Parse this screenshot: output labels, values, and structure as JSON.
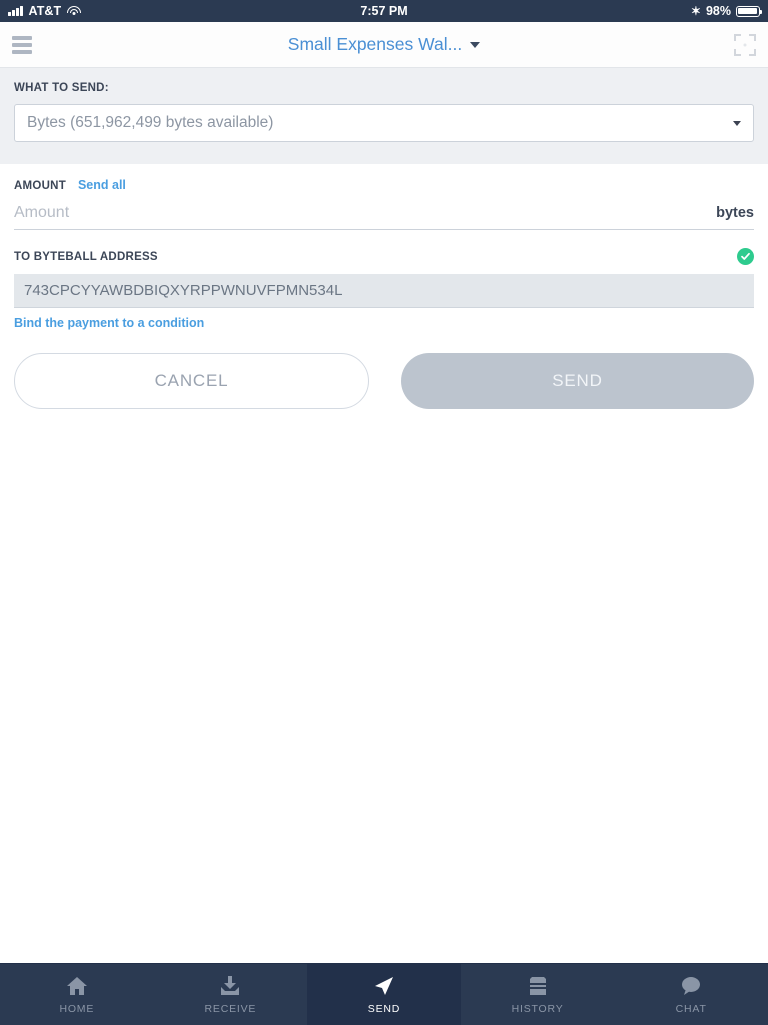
{
  "statusbar": {
    "carrier": "AT&T",
    "time": "7:57 PM",
    "battery": "98%",
    "bluetooth_icon": "bluetooth-icon",
    "wifi_icon": "wifi-icon",
    "signal_icon": "signal-bars-icon"
  },
  "navbar": {
    "menu_icon": "hamburger-menu-icon",
    "title": "Small Expenses Wal...",
    "caret_icon": "chevron-down-icon",
    "scan_icon": "scan-qr-icon"
  },
  "what_to_send": {
    "label": "WHAT TO SEND:",
    "selected": "Bytes (651,962,499 bytes available)",
    "options": [
      "Bytes (651,962,499 bytes available)"
    ],
    "arrow_icon": "dropdown-arrow-icon"
  },
  "amount": {
    "label": "AMOUNT",
    "send_all_label": "Send all",
    "value": "",
    "placeholder": "Amount",
    "unit": "bytes"
  },
  "address": {
    "label": "TO BYTEBALL ADDRESS",
    "value": "743CPCYYAWBDBIQXYRPPWNUVFPMN534L",
    "placeholder": "",
    "valid_icon": "check-circle-icon",
    "bind_link_label": "Bind the payment to a condition"
  },
  "actions": {
    "cancel_label": "CANCEL",
    "send_label": "SEND"
  },
  "tabbar": {
    "items": [
      {
        "label": "HOME",
        "icon": "home-icon",
        "active": false
      },
      {
        "label": "RECEIVE",
        "icon": "receive-icon",
        "active": false
      },
      {
        "label": "SEND",
        "icon": "send-icon",
        "active": true
      },
      {
        "label": "HISTORY",
        "icon": "history-icon",
        "active": false
      },
      {
        "label": "CHAT",
        "icon": "chat-icon",
        "active": false
      }
    ]
  },
  "colors": {
    "status_bar": "#2b3a52",
    "accent_blue": "#4a8fd4",
    "link_blue": "#4a9ee0",
    "valid_green": "#2ecb8e",
    "send_disabled": "#bcc4ce",
    "section_gray": "#eef0f3"
  }
}
